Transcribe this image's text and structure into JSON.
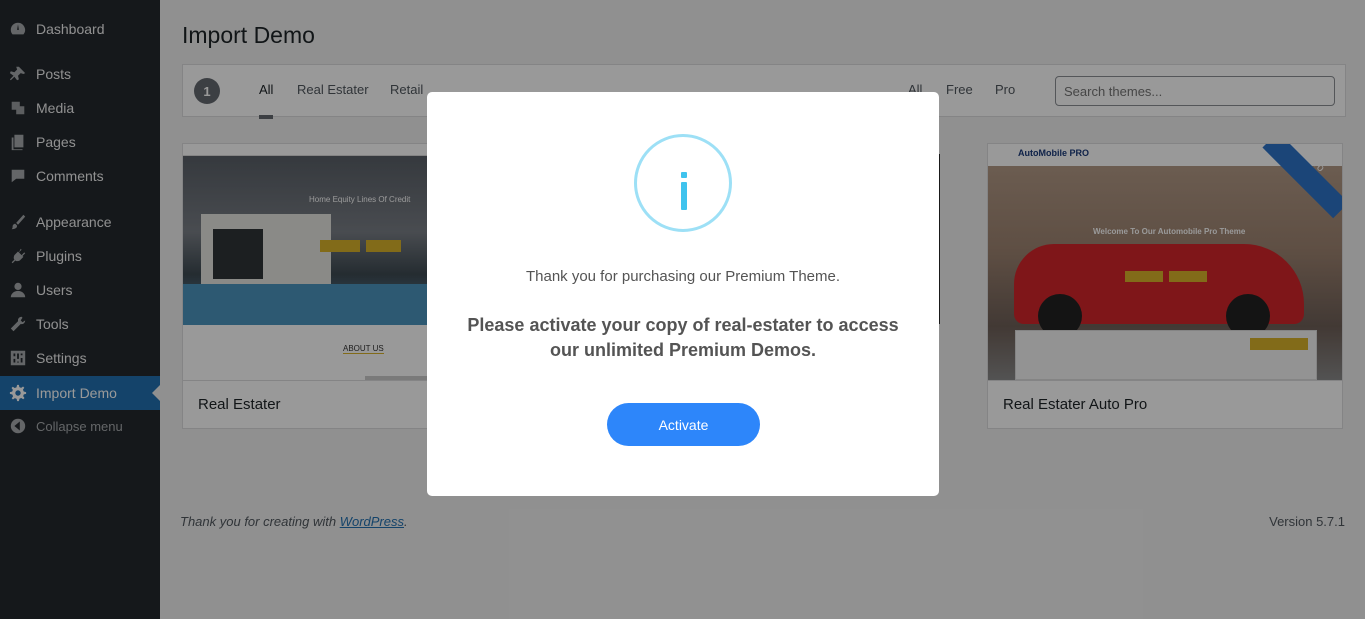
{
  "sidebar": {
    "items": [
      {
        "label": "Dashboard",
        "icon": "dashboard-icon"
      },
      {
        "label": "Posts",
        "icon": "pin-icon"
      },
      {
        "label": "Media",
        "icon": "media-icon"
      },
      {
        "label": "Pages",
        "icon": "pages-icon"
      },
      {
        "label": "Comments",
        "icon": "comment-icon"
      },
      {
        "label": "Appearance",
        "icon": "brush-icon"
      },
      {
        "label": "Plugins",
        "icon": "plug-icon"
      },
      {
        "label": "Users",
        "icon": "user-icon"
      },
      {
        "label": "Tools",
        "icon": "wrench-icon"
      },
      {
        "label": "Settings",
        "icon": "settings-sliders-icon"
      },
      {
        "label": "Import Demo",
        "icon": "gear-icon"
      },
      {
        "label": "Collapse menu",
        "icon": "collapse-arrow-icon"
      }
    ]
  },
  "page": {
    "title": "Import Demo"
  },
  "filter": {
    "count": "1",
    "category_tabs": [
      "All",
      "Real Estater",
      "Retail"
    ],
    "type_tabs": [
      "All",
      "Free",
      "Pro"
    ],
    "search_placeholder": "Search themes..."
  },
  "themes": [
    {
      "name": "Real Estater",
      "shot_heading": "Home Equity Lines Of Credit",
      "shot_section": "ABOUT US"
    },
    {
      "name": "Real Estater Auto Pro",
      "shot_brand": "AutoMobile PRO",
      "shot_heading": "Welcome To Our Automobile Pro Theme",
      "ribbon": "Pro"
    }
  ],
  "footer": {
    "thanks_prefix": "Thank you for creating with ",
    "thanks_link": "WordPress",
    "thanks_suffix": ".",
    "version": "Version 5.7.1"
  },
  "modal": {
    "message": "Thank you for purchasing our Premium Theme.",
    "prompt": "Please activate your copy of real-estater to access our unlimited Premium Demos.",
    "button_label": "Activate"
  },
  "colors": {
    "sidebar_bg": "#23282d",
    "accent": "#2271b1",
    "info_icon": "#3fc3ee",
    "button": "#2d86fa"
  }
}
